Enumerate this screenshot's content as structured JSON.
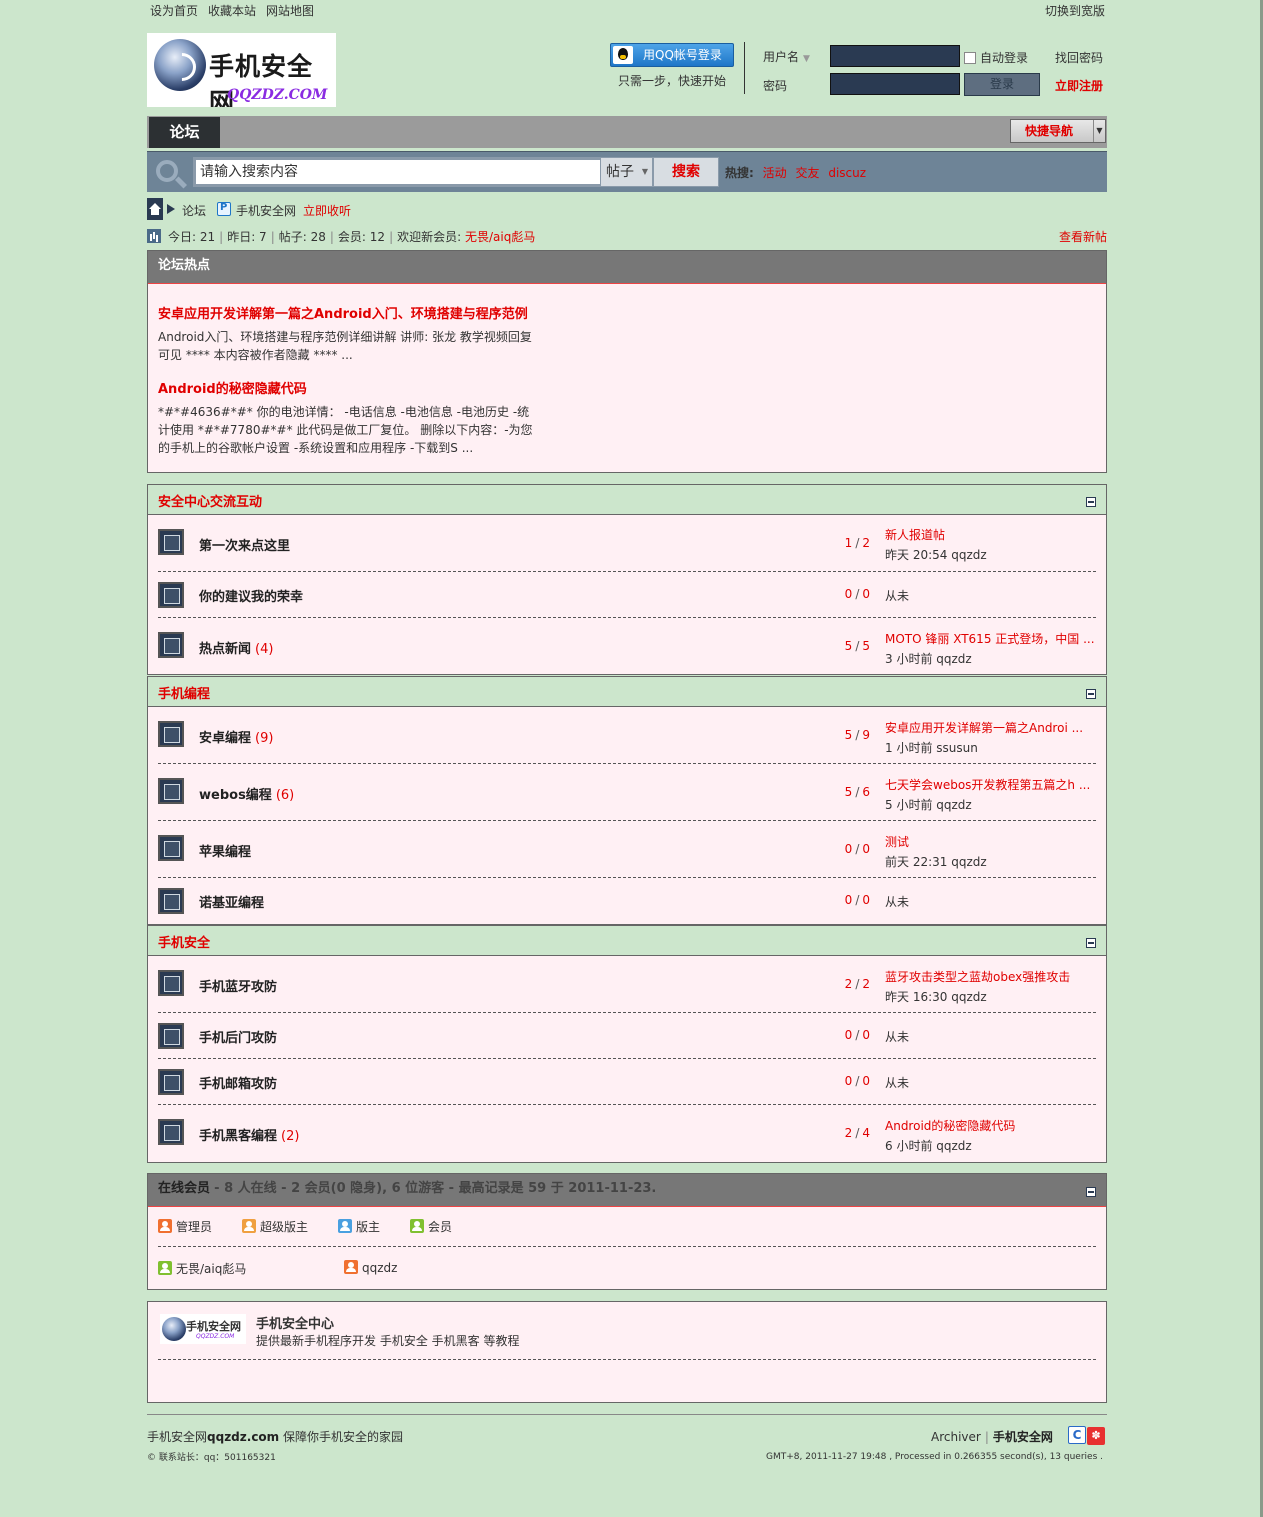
{
  "topbar": {
    "links": [
      "设为首页",
      "收藏本站",
      "网站地图"
    ],
    "right": "切换到宽版"
  },
  "logo": {
    "title": "手机安全网",
    "url": "QQZDZ.COM"
  },
  "login": {
    "qq_button": "用QQ帐号登录",
    "qq_sub": "只需一步，快速开始",
    "username_label": "用户名",
    "password_label": "密码",
    "auto_login": "自动登录",
    "find_password": "找回密码",
    "login_button": "登录",
    "register": "立即注册"
  },
  "nav": {
    "tab": "论坛",
    "quick_nav": "快捷导航"
  },
  "search": {
    "placeholder": "请输入搜索内容",
    "type": "帖子",
    "button": "搜索",
    "hot_label": "热搜:",
    "hot": [
      "活动",
      "交友",
      "discuz"
    ]
  },
  "breadcrumb": {
    "forum": "论坛",
    "site": "手机安全网",
    "subscribe": "立即收听"
  },
  "stats": {
    "today": "今日: 21",
    "yesterday": "昨日: 7",
    "posts": "帖子: 28",
    "members": "会员: 12",
    "welcome": "欢迎新会员:",
    "new_member": "无畏/aiq彪马",
    "new_posts": "查看新帖"
  },
  "hot": {
    "header": "论坛热点",
    "items": [
      {
        "title": "安卓应用开发详解第一篇之Android入门、环境搭建与程序范例",
        "desc": "Android入门、环境搭建与程序范例详细讲解 讲师: 张龙 教学视频回复可见 **** 本内容被作者隐藏 **** ..."
      },
      {
        "title": "Android的秘密隐藏代码",
        "desc": "*#*#4636#*#* 你的电池详情： -电话信息 -电池信息 -电池历史 -统计使用 *#*#7780#*#* 此代码是做工厂复位。 删除以下内容：-为您的手机上的谷歌帐户设置 -系统设置和应用程序 -下载到S ..."
      }
    ]
  },
  "sections": [
    {
      "title": "安全中心交流互动",
      "forums": [
        {
          "name": "第一次来点这里",
          "count": "",
          "threads": "1",
          "posts": "2",
          "last_title": "新人报道帖",
          "last_meta": "昨天 20:54 qqzdz"
        },
        {
          "name": "你的建议我的荣幸",
          "count": "",
          "threads": "0",
          "posts": "0",
          "last_title": "",
          "last_meta": "从未"
        },
        {
          "name": "热点新闻",
          "count": "(4)",
          "threads": "5",
          "posts": "5",
          "last_title": "MOTO 锋丽 XT615 正式登场，中国 ...",
          "last_meta": "3 小时前 qqzdz"
        }
      ]
    },
    {
      "title": "手机编程",
      "forums": [
        {
          "name": "安卓编程",
          "count": "(9)",
          "threads": "5",
          "posts": "9",
          "last_title": "安卓应用开发详解第一篇之Androi ...",
          "last_meta": "1 小时前 ssusun"
        },
        {
          "name": "webos编程",
          "count": "(6)",
          "threads": "5",
          "posts": "6",
          "last_title": "七天学会webos开发教程第五篇之h ...",
          "last_meta": "5 小时前 qqzdz"
        },
        {
          "name": "苹果编程",
          "count": "",
          "threads": "0",
          "posts": "0",
          "last_title": "测试",
          "last_meta": "前天 22:31 qqzdz"
        },
        {
          "name": "诺基亚编程",
          "count": "",
          "threads": "0",
          "posts": "0",
          "last_title": "",
          "last_meta": "从未"
        }
      ]
    },
    {
      "title": "手机安全",
      "forums": [
        {
          "name": "手机蓝牙攻防",
          "count": "",
          "threads": "2",
          "posts": "2",
          "last_title": "蓝牙攻击类型之蓝劫obex强推攻击",
          "last_meta": "昨天 16:30 qqzdz"
        },
        {
          "name": "手机后门攻防",
          "count": "",
          "threads": "0",
          "posts": "0",
          "last_title": "",
          "last_meta": "从未"
        },
        {
          "name": "手机邮箱攻防",
          "count": "",
          "threads": "0",
          "posts": "0",
          "last_title": "",
          "last_meta": "从未"
        },
        {
          "name": "手机黑客编程",
          "count": "(2)",
          "threads": "2",
          "posts": "4",
          "last_title": "Android的秘密隐藏代码",
          "last_meta": "6 小时前 qqzdz"
        }
      ]
    }
  ],
  "online": {
    "title": "在线会员",
    "summary": "- 8 人在线 - 2 会员(0 隐身), 6 位游客 - 最高记录是 59 于 2011-11-23.",
    "legend": [
      "管理员",
      "超级版主",
      "版主",
      "会员"
    ],
    "users": [
      "无畏/aiq彪马",
      "qqzdz"
    ]
  },
  "footer_box": {
    "title": "手机安全中心",
    "desc": "提供最新手机程序开发 手机安全 手机黑客 等教程"
  },
  "footer": {
    "line1_prefix": "手机安全网",
    "line1_domain": "qqzdz.com",
    "line1_suffix": " 保障你手机安全的家园",
    "line2": "© 联系站长：qq：501165321",
    "archiver": "Archiver",
    "site": "手机安全网",
    "processed": "GMT+8, 2011-11-27 19:48 , Processed in 0.266355 second(s), 13 queries ."
  }
}
